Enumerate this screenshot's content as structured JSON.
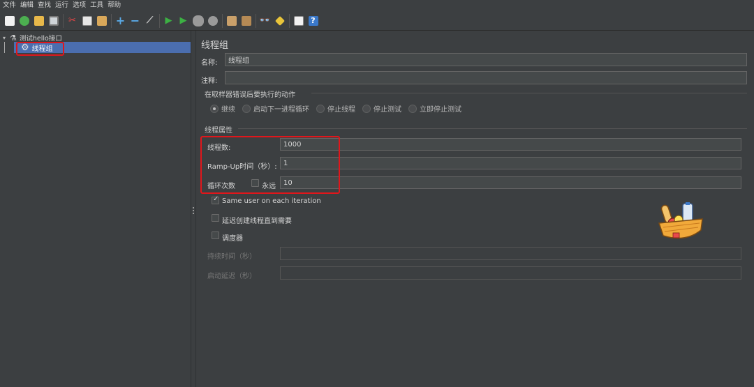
{
  "menu": [
    "文件",
    "编辑",
    "查找",
    "运行",
    "选项",
    "工具",
    "帮助"
  ],
  "toolbar_icons": [
    "new-icon",
    "templates-icon",
    "open-icon",
    "save-icon",
    "cut-icon",
    "copy-icon",
    "paste-icon",
    "expand-icon",
    "collapse-icon",
    "toggle-icon",
    "start-icon",
    "start-no-pause-icon",
    "stop-icon",
    "shutdown-icon",
    "clear-icon",
    "clear-all-icon",
    "search-icon",
    "reset-search-icon",
    "function-helper-icon",
    "help-icon"
  ],
  "tree": {
    "root_label": "测试hello接口",
    "child_label": "线程组"
  },
  "panel": {
    "title": "线程组",
    "name_label": "名称:",
    "name_value": "线程组",
    "comment_label": "注释:",
    "comment_value": "",
    "error_section": "在取样器错误后要执行的动作",
    "error_options": [
      "继续",
      "启动下一进程循环",
      "停止线程",
      "停止测试",
      "立即停止测试"
    ],
    "error_selected": "继续",
    "props_section": "线程属性",
    "threads_label": "线程数:",
    "threads_value": "1000",
    "rampup_label": "Ramp-Up时间（秒）:",
    "rampup_value": "1",
    "loop_label": "循环次数",
    "forever_label": "永远",
    "loop_value": "10",
    "same_user_label": "Same user on each iteration",
    "delay_label": "延迟创建线程直到需要",
    "scheduler_label": "调度器",
    "duration_label": "持续时间（秒）",
    "duration_value": "",
    "startup_delay_label": "启动延迟（秒）",
    "startup_delay_value": ""
  },
  "colors": {
    "background": "#3c3f41",
    "selection": "#4b6eaf",
    "highlight": "#e0161b"
  }
}
